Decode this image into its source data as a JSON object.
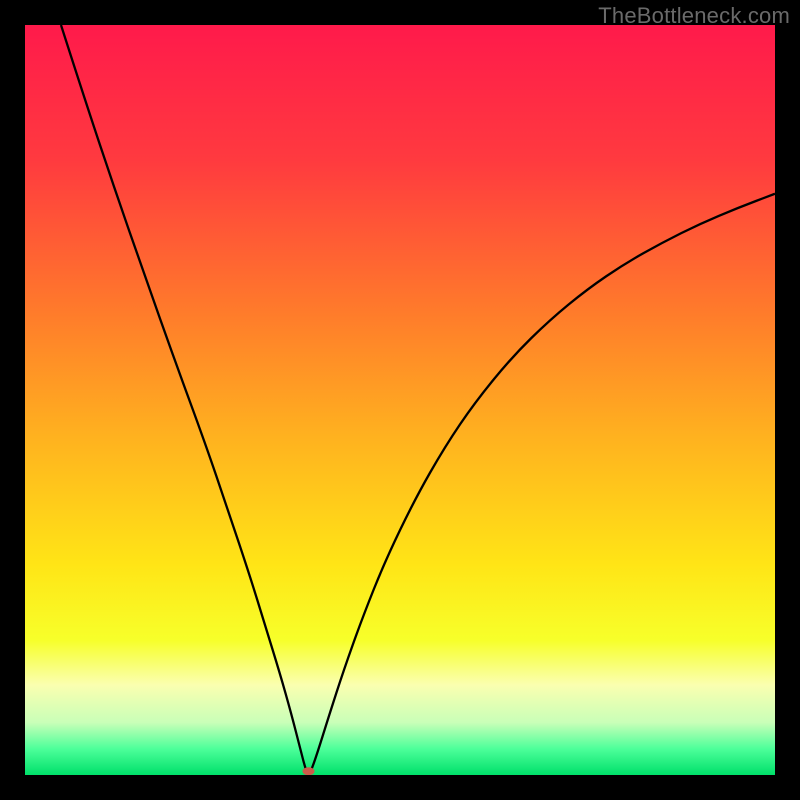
{
  "watermark": "TheBottleneck.com",
  "chart_data": {
    "type": "line",
    "title": "",
    "xlabel": "",
    "ylabel": "",
    "xlim": [
      0,
      100
    ],
    "ylim": [
      0,
      100
    ],
    "grid": false,
    "background_gradient": {
      "stops": [
        {
          "offset": 0.0,
          "color": "#ff1a4b"
        },
        {
          "offset": 0.18,
          "color": "#ff3a3f"
        },
        {
          "offset": 0.38,
          "color": "#ff7a2b"
        },
        {
          "offset": 0.55,
          "color": "#ffb21f"
        },
        {
          "offset": 0.72,
          "color": "#ffe516"
        },
        {
          "offset": 0.82,
          "color": "#f7ff2a"
        },
        {
          "offset": 0.88,
          "color": "#faffb0"
        },
        {
          "offset": 0.93,
          "color": "#c9ffb8"
        },
        {
          "offset": 0.965,
          "color": "#4dff9a"
        },
        {
          "offset": 1.0,
          "color": "#00e06a"
        }
      ]
    },
    "series": [
      {
        "name": "bottleneck-curve",
        "color": "#000000",
        "stroke_width": 2.3,
        "points": [
          {
            "x": 4.8,
            "y": 100.0
          },
          {
            "x": 8.0,
            "y": 90.0
          },
          {
            "x": 12.0,
            "y": 78.0
          },
          {
            "x": 16.0,
            "y": 66.5
          },
          {
            "x": 20.0,
            "y": 55.2
          },
          {
            "x": 24.0,
            "y": 44.3
          },
          {
            "x": 27.0,
            "y": 35.5
          },
          {
            "x": 30.0,
            "y": 26.5
          },
          {
            "x": 32.0,
            "y": 20.0
          },
          {
            "x": 34.0,
            "y": 13.5
          },
          {
            "x": 35.5,
            "y": 8.2
          },
          {
            "x": 36.7,
            "y": 3.5
          },
          {
            "x": 37.4,
            "y": 0.8
          },
          {
            "x": 37.8,
            "y": 0.0
          },
          {
            "x": 38.2,
            "y": 0.7
          },
          {
            "x": 39.0,
            "y": 3.0
          },
          {
            "x": 40.5,
            "y": 7.8
          },
          {
            "x": 42.5,
            "y": 14.0
          },
          {
            "x": 45.0,
            "y": 21.0
          },
          {
            "x": 48.0,
            "y": 28.5
          },
          {
            "x": 52.0,
            "y": 36.8
          },
          {
            "x": 56.0,
            "y": 43.8
          },
          {
            "x": 60.0,
            "y": 49.7
          },
          {
            "x": 65.0,
            "y": 55.8
          },
          {
            "x": 70.0,
            "y": 60.7
          },
          {
            "x": 75.0,
            "y": 64.8
          },
          {
            "x": 80.0,
            "y": 68.2
          },
          {
            "x": 85.0,
            "y": 71.0
          },
          {
            "x": 90.0,
            "y": 73.5
          },
          {
            "x": 95.0,
            "y": 75.6
          },
          {
            "x": 100.0,
            "y": 77.5
          }
        ]
      }
    ],
    "marker": {
      "x": 37.8,
      "y": 0.5,
      "fill": "#cc5a4a",
      "rx": 6,
      "ry": 4
    }
  }
}
